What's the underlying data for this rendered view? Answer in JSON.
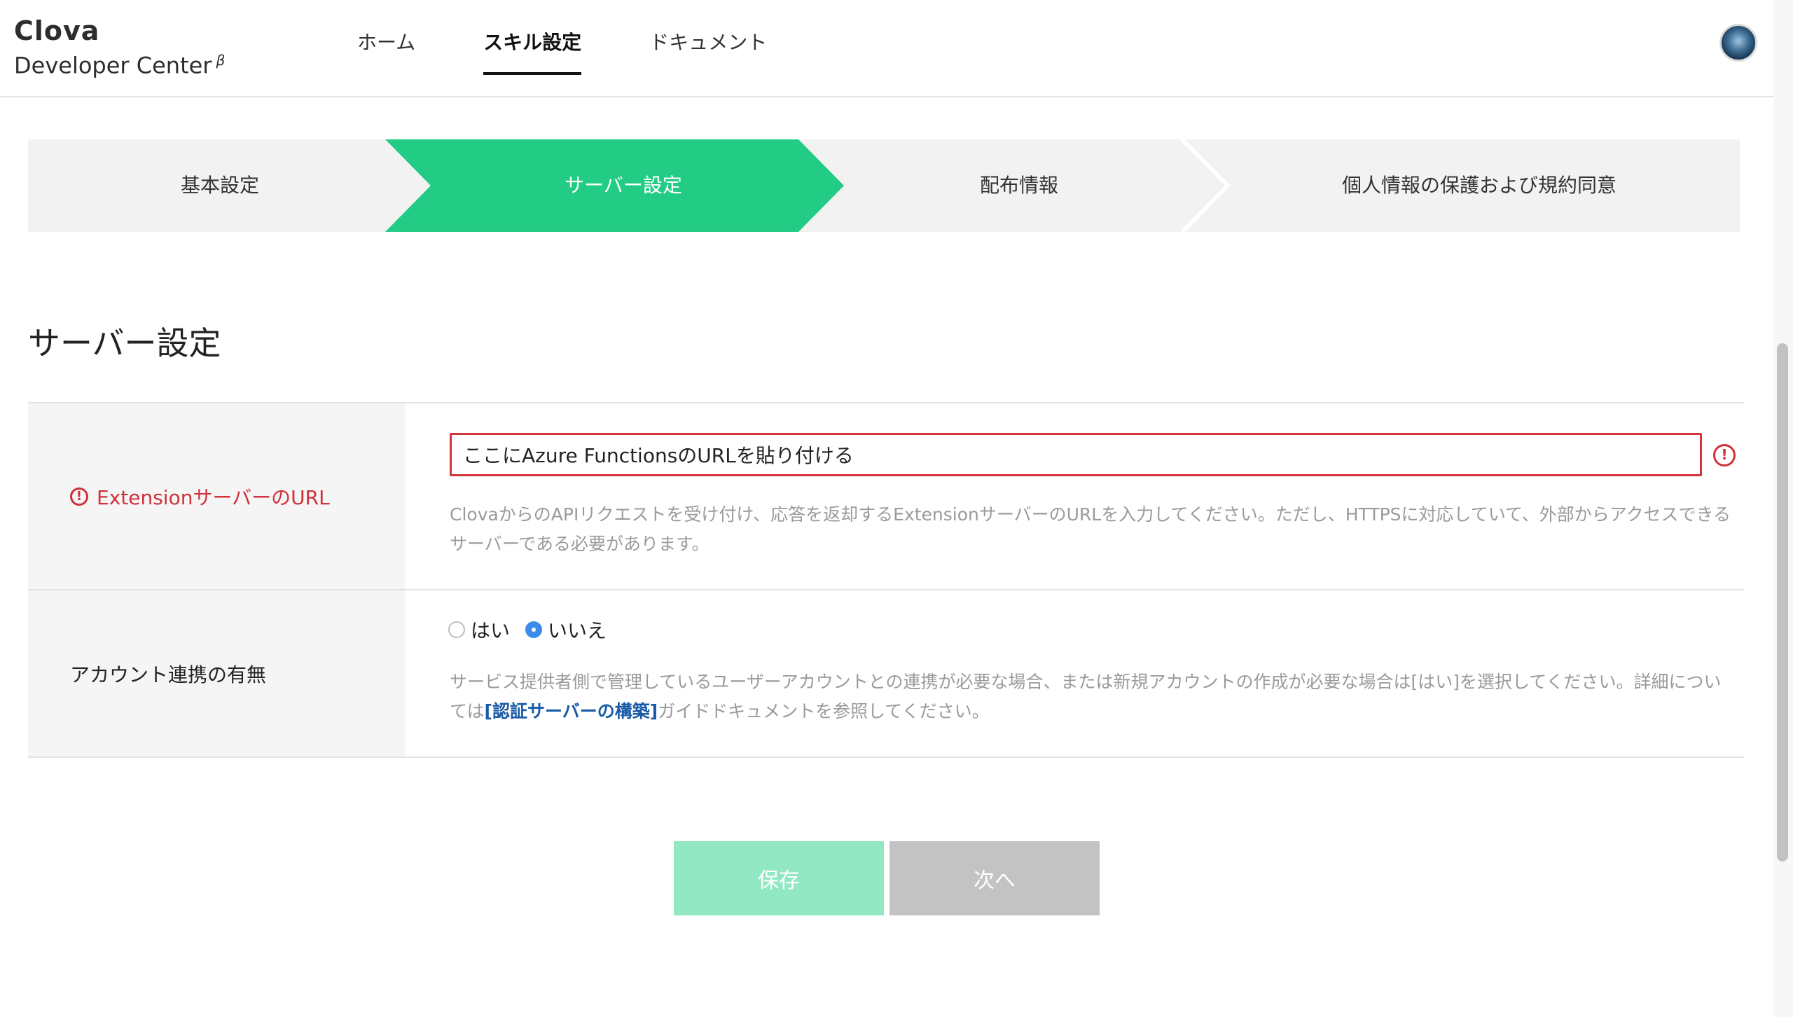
{
  "header": {
    "logo_title": "Clova",
    "logo_sub": "Developer Center",
    "logo_beta": "β",
    "nav": [
      {
        "label": "ホーム",
        "active": false
      },
      {
        "label": "スキル設定",
        "active": true
      },
      {
        "label": "ドキュメント",
        "active": false
      }
    ]
  },
  "steps": [
    {
      "label": "基本設定",
      "active": false
    },
    {
      "label": "サーバー設定",
      "active": true
    },
    {
      "label": "配布情報",
      "active": false
    },
    {
      "label": "個人情報の保護および規約同意",
      "active": false
    }
  ],
  "section_title": "サーバー設定",
  "extension_url": {
    "label": "ExtensionサーバーのURL",
    "value": "ここにAzure FunctionsのURLを貼り付ける",
    "help": "ClovaからのAPIリクエストを受け付け、応答を返却するExtensionサーバーのURLを入力してください。ただし、HTTPSに対応していて、外部からアクセスできるサーバーである必要があります。",
    "error_icon": "exclamation-circle-icon"
  },
  "account_linking": {
    "label": "アカウント連携の有無",
    "options": [
      {
        "label": "はい",
        "checked": false
      },
      {
        "label": "いいえ",
        "checked": true
      }
    ],
    "help_before": "サービス提供者側で管理しているユーザーアカウントとの連携が必要な場合、または新規アカウントの作成が必要な場合は[はい]を選択してください。詳細については",
    "help_link": "[認証サーバーの構築]",
    "help_after": "ガイドドキュメントを参照してください。"
  },
  "buttons": {
    "save": "保存",
    "next": "次へ"
  },
  "colors": {
    "accent_green": "#22cc85",
    "error_red": "#d0313b",
    "link_blue": "#1a5aa6"
  }
}
